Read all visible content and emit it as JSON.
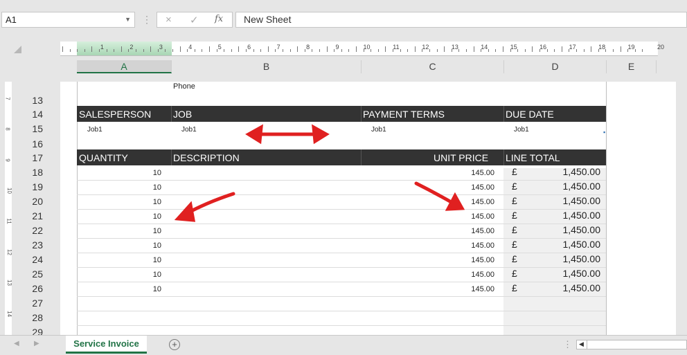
{
  "formula_bar": {
    "name_box": "A1",
    "cancel_icon": "×",
    "enter_icon": "✓",
    "fx_label": "fx",
    "formula_value": "New Sheet"
  },
  "ruler": {
    "numbers": [
      "1",
      "2",
      "3",
      "4",
      "5",
      "6",
      "7",
      "8",
      "9",
      "10",
      "11",
      "12",
      "13",
      "14",
      "15",
      "16",
      "17",
      "18",
      "19",
      "20"
    ]
  },
  "columns": [
    "A",
    "B",
    "C",
    "D",
    "E"
  ],
  "rows": [
    "13",
    "14",
    "15",
    "16",
    "17",
    "18",
    "19",
    "20",
    "21",
    "22",
    "23",
    "24",
    "25",
    "26",
    "27",
    "28",
    "29"
  ],
  "vertical_ruler": [
    "7",
    "8",
    "9",
    "10",
    "11",
    "12",
    "13",
    "14"
  ],
  "sheet": {
    "phone_label": "Phone",
    "header1": {
      "salesperson": "SALESPERSON",
      "job": "JOB",
      "payment_terms": "PAYMENT TERMS",
      "due_date": "DUE DATE"
    },
    "values1": {
      "salesperson": "Job1",
      "job": "Job1",
      "payment_terms": "Job1",
      "due_date": "Job1"
    },
    "header2": {
      "quantity": "QUANTITY",
      "description": "DESCRIPTION",
      "unit_price": "UNIT PRICE",
      "line_total": "LINE TOTAL"
    },
    "line_items": [
      {
        "qty": "10",
        "unit_price": "145.00",
        "currency": "£",
        "line_total": "1,450.00"
      },
      {
        "qty": "10",
        "unit_price": "145.00",
        "currency": "£",
        "line_total": "1,450.00"
      },
      {
        "qty": "10",
        "unit_price": "145.00",
        "currency": "£",
        "line_total": "1,450.00"
      },
      {
        "qty": "10",
        "unit_price": "145.00",
        "currency": "£",
        "line_total": "1,450.00"
      },
      {
        "qty": "10",
        "unit_price": "145.00",
        "currency": "£",
        "line_total": "1,450.00"
      },
      {
        "qty": "10",
        "unit_price": "145.00",
        "currency": "£",
        "line_total": "1,450.00"
      },
      {
        "qty": "10",
        "unit_price": "145.00",
        "currency": "£",
        "line_total": "1,450.00"
      },
      {
        "qty": "10",
        "unit_price": "145.00",
        "currency": "£",
        "line_total": "1,450.00"
      },
      {
        "qty": "10",
        "unit_price": "145.00",
        "currency": "£",
        "line_total": "1,450.00"
      }
    ]
  },
  "tabs": {
    "active": "Service Invoice",
    "add_icon": "+"
  },
  "colors": {
    "accent": "#217346",
    "header_bar": "#333333",
    "annotation": "#e02020"
  }
}
